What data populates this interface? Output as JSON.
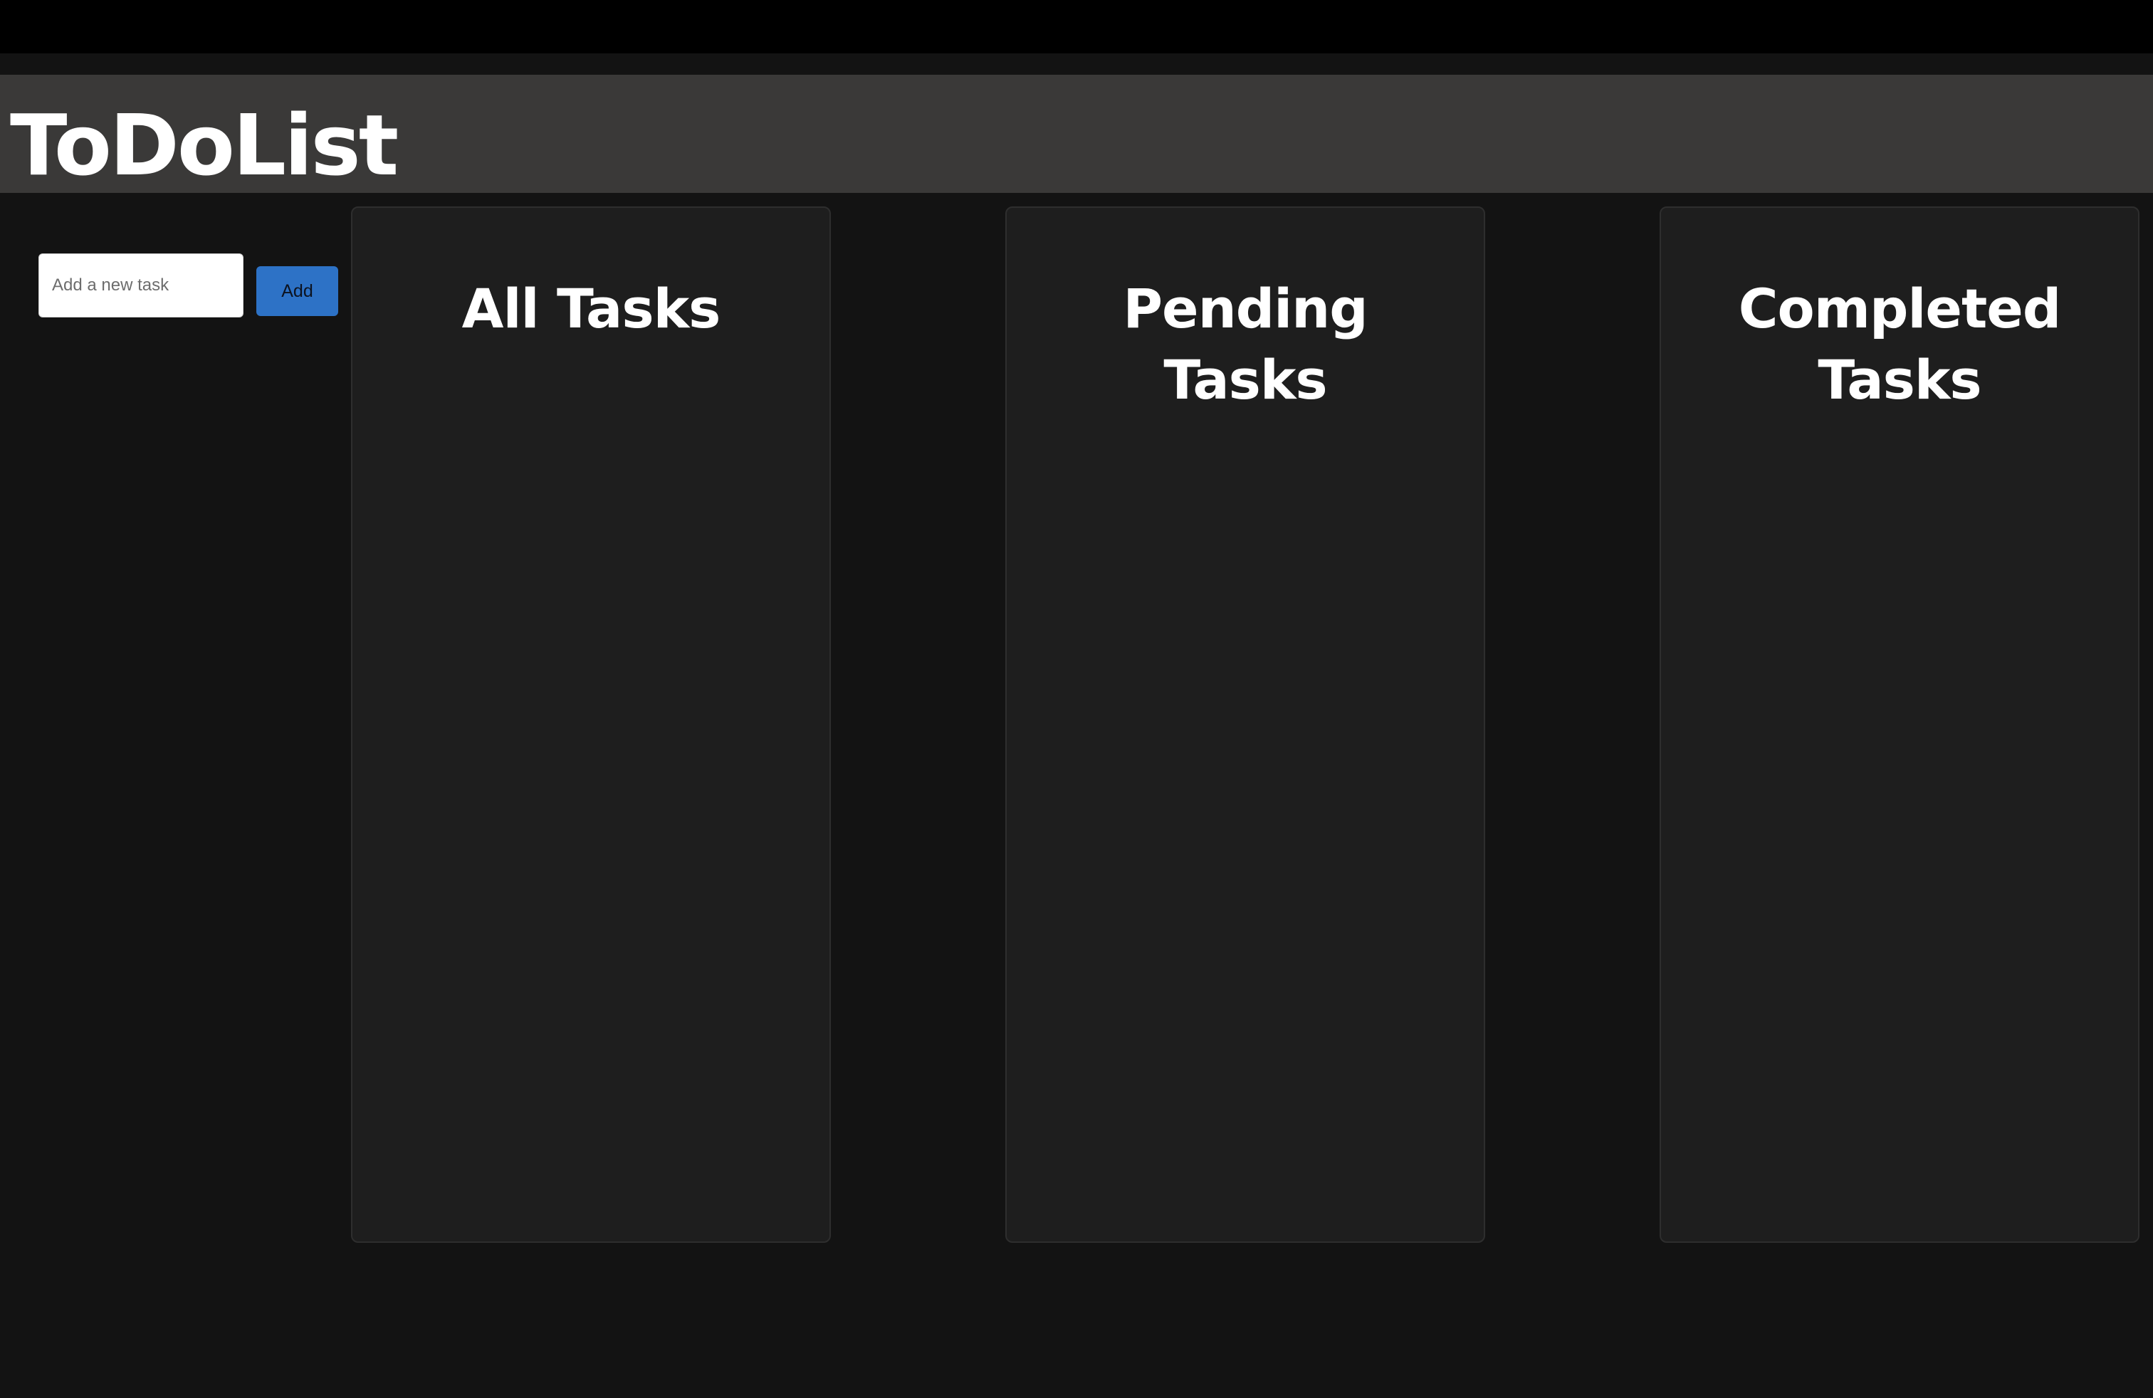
{
  "header": {
    "title": "ToDoList"
  },
  "add_form": {
    "placeholder": "Add a new task",
    "value": "",
    "button_label": "Add"
  },
  "columns": [
    {
      "title": "All Tasks",
      "tasks": []
    },
    {
      "title": "Pending Tasks",
      "tasks": []
    },
    {
      "title": "Completed Tasks",
      "tasks": []
    }
  ],
  "colors": {
    "background": "#131313",
    "header": "#3a3938",
    "panel": "#1e1e1e",
    "accent": "#2d72c6"
  }
}
